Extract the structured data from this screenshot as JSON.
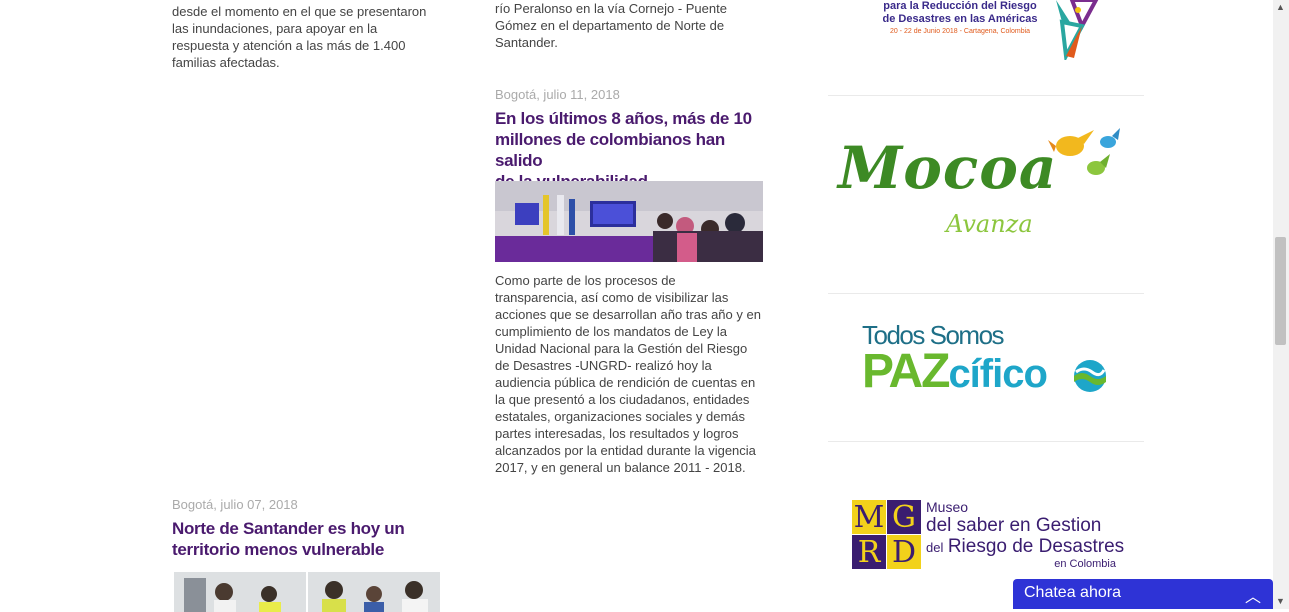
{
  "article_left_top": {
    "text_lines": [
      "desde el momento en el que se presentaron",
      "las inundaciones,  para apoyar en la",
      "respuesta y atención a las más de 1.400",
      "familias afectadas."
    ]
  },
  "article_mid_top": {
    "text_lines": [
      "río Peralonso en la vía Cornejo - Puente",
      "Gómez en el departamento de Norte de",
      "Santander."
    ]
  },
  "article_mid": {
    "date": "Bogotá, julio 11, 2018",
    "title_lines": [
      "En los últimos 8 años, más de 10",
      "millones de colombianos han salido",
      "de la vulnerabilidad"
    ],
    "body_lines": [
      "Como parte de los procesos de",
      "transparencia, así como de visibilizar las",
      "acciones que se desarrollan año tras año y en",
      "cumplimiento de los mandatos de Ley la",
      "Unidad Nacional para la Gestión del Riesgo",
      "de Desastres -UNGRD- realizó hoy la",
      "audiencia pública de rendición de cuentas en",
      "la que presentó a los ciudadanos, entidades",
      "estatales, organizaciones sociales y demás",
      "partes interesadas, los resultados y logros",
      "alcanzados por la entidad durante la vigencia",
      "2017, y en general un balance 2011 - 2018."
    ]
  },
  "article_left": {
    "date": "Bogotá, julio 07, 2018",
    "title_lines": [
      "Norte de Santander es hoy un",
      "territorio menos vulnerable"
    ]
  },
  "sidebar": {
    "plataforma": {
      "line1": "para la Reducción del Riesgo",
      "line2": "de Desastres en las Américas",
      "line3": "20 - 22 de Junio 2018 - Cartagena, Colombia"
    },
    "mocoa": {
      "word": "Mocoa",
      "sub": "Avanza"
    },
    "paz": {
      "line1": "Todos Somos",
      "paz": "PAZ",
      "cifico": "cífico"
    },
    "museo": {
      "letters": [
        "M",
        "G",
        "R",
        "D"
      ],
      "line1": "Museo",
      "line2": "del saber en Gestion",
      "line3_small": "del",
      "line3": "Riesgo de Desastres",
      "line4": "en Colombia"
    }
  },
  "chat": {
    "label": "Chatea ahora"
  },
  "colors": {
    "title": "#4a1a6e",
    "chat": "#2e33d6",
    "mocoa_green": "#3d8a24",
    "paz_green": "#69b82e",
    "museo_purple": "#3a1d70",
    "museo_yellow": "#f2d21b"
  }
}
